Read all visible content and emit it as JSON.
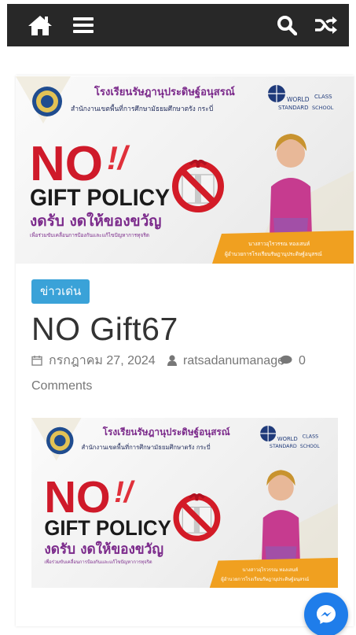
{
  "header": {
    "icons": [
      "home-icon",
      "menu-icon",
      "search-icon",
      "shuffle-icon"
    ],
    "background": "#282828"
  },
  "post": {
    "category": "ข่าวเด่น",
    "title": "NO Gift67",
    "date": "กรกฎาคม 27, 2024",
    "author": "ratsadanumanage",
    "comments_count": "0",
    "comments_label": "Comments"
  },
  "banner": {
    "school_name": "โรงเรียนรัษฎานุประดิษฐ์อนุสรณ์",
    "office": "สำนักงานเขตพื้นที่การศึกษามัธยมศึกษาตรัง กระบี่",
    "world": "WORLD",
    "class": "CLASS",
    "standard": "STANDARD",
    "school": "SCHOOL",
    "no": "NO",
    "excl": "!/",
    "policy": "GIFT POLICY",
    "slogan": "งดรับ งดให้ของขวัญ",
    "tagline": "เพื่อร่วมขับเคลื่อนการป้องกันและแก้ไขปัญหาการทุจริต",
    "person_name": "นางสาวอุไรวรรณ ทองเสนห์",
    "person_title": "ผู้อำนวยการโรงเรียนรัษฎานุประดิษฐ์อนุสรณ์"
  },
  "colors": {
    "accent": "#3aa2d8",
    "no_red": "#cf1a2a",
    "slogan_purple": "#7b2a8b",
    "orange": "#f0a020",
    "messenger": "#1f7dea"
  },
  "floating": {
    "icon": "messenger-icon"
  }
}
